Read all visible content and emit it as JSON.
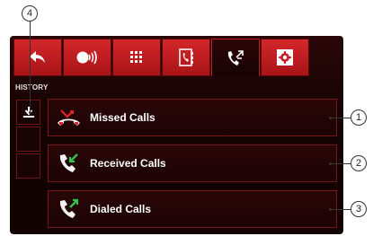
{
  "tabs": [
    {
      "name": "back",
      "icon": "back-arrow-icon"
    },
    {
      "name": "voice",
      "icon": "voice-dial-icon"
    },
    {
      "name": "keypad",
      "icon": "keypad-icon"
    },
    {
      "name": "contacts",
      "icon": "phonebook-icon"
    },
    {
      "name": "call-history",
      "icon": "call-history-icon",
      "active": true
    },
    {
      "name": "settings",
      "icon": "settings-gear-icon"
    }
  ],
  "section_label": "HISTORY",
  "side_buttons": [
    {
      "icon": "download-icon"
    },
    {
      "icon": ""
    },
    {
      "icon": ""
    }
  ],
  "rows": [
    {
      "label": "Missed Calls",
      "icon": "missed-call-icon"
    },
    {
      "label": "Received Calls",
      "icon": "received-call-icon"
    },
    {
      "label": "Dialed Calls",
      "icon": "dialed-call-icon"
    }
  ],
  "callouts": [
    "1",
    "2",
    "3",
    "4"
  ],
  "colors": {
    "accent_red": "#c8202a",
    "background": "#1a0304",
    "missed": "#e0242a",
    "received_dialed": "#35c24a"
  }
}
